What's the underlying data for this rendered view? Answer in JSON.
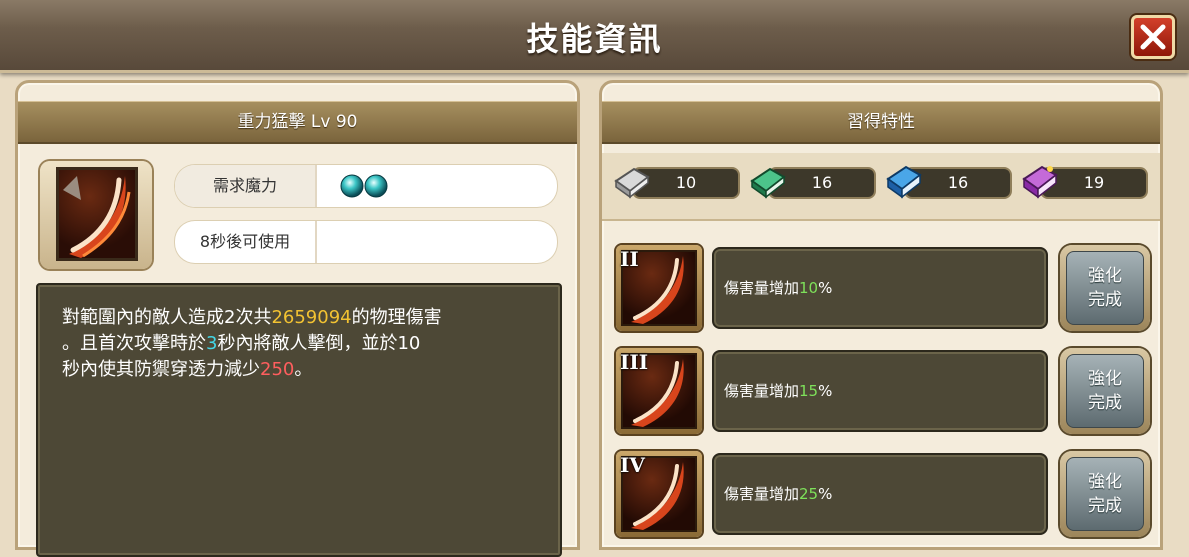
{
  "window": {
    "title": "技能資訊"
  },
  "colors": {
    "accent_gold": "#f2c232",
    "accent_cyan": "#43d6e6",
    "accent_red": "#ff5e5e",
    "accent_green": "#7ee15a"
  },
  "skill": {
    "header": "重力猛擊 Lv 90",
    "icon": "slash-skill-icon",
    "mana_label": "需求魔力",
    "mana_orbs": 2,
    "cooldown_label": "8秒後可使用",
    "description": {
      "part1": "對範圍內的敵人造成2次共",
      "damage": "2659094",
      "part2": "的物理傷害",
      "part3": "。且首次攻擊時於",
      "stun_seconds": "3",
      "part4": "秒內將敵人擊倒，並於10",
      "part5": "秒內使其防禦穿透力減少",
      "reduction": "250",
      "part6": "。"
    }
  },
  "traits_panel": {
    "header": "習得特性",
    "books": [
      {
        "icon": "silver-book-icon",
        "count": "10"
      },
      {
        "icon": "green-book-icon",
        "count": "16"
      },
      {
        "icon": "blue-book-icon",
        "count": "16"
      },
      {
        "icon": "purple-book-icon",
        "count": "19"
      }
    ],
    "traits": [
      {
        "rank": "II",
        "text": "傷害量增加",
        "value": "10",
        "unit": "%",
        "button_line1": "強化",
        "button_line2": "完成"
      },
      {
        "rank": "III",
        "text": "傷害量增加",
        "value": "15",
        "unit": "%",
        "button_line1": "強化",
        "button_line2": "完成"
      },
      {
        "rank": "IV",
        "text": "傷害量增加",
        "value": "25",
        "unit": "%",
        "button_line1": "強化",
        "button_line2": "完成"
      }
    ]
  }
}
